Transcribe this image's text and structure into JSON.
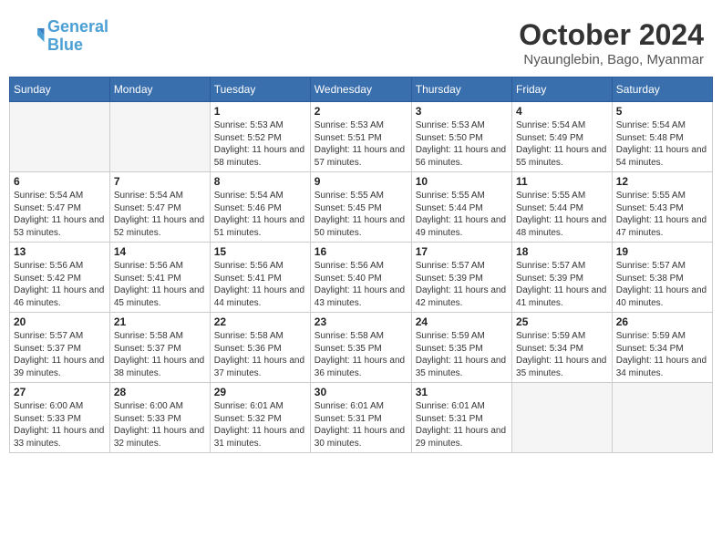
{
  "header": {
    "logo_line1": "General",
    "logo_line2": "Blue",
    "month_title": "October 2024",
    "location": "Nyaunglebin, Bago, Myanmar"
  },
  "weekdays": [
    "Sunday",
    "Monday",
    "Tuesday",
    "Wednesday",
    "Thursday",
    "Friday",
    "Saturday"
  ],
  "weeks": [
    [
      {
        "day": "",
        "info": ""
      },
      {
        "day": "",
        "info": ""
      },
      {
        "day": "1",
        "info": "Sunrise: 5:53 AM\nSunset: 5:52 PM\nDaylight: 11 hours and 58 minutes."
      },
      {
        "day": "2",
        "info": "Sunrise: 5:53 AM\nSunset: 5:51 PM\nDaylight: 11 hours and 57 minutes."
      },
      {
        "day": "3",
        "info": "Sunrise: 5:53 AM\nSunset: 5:50 PM\nDaylight: 11 hours and 56 minutes."
      },
      {
        "day": "4",
        "info": "Sunrise: 5:54 AM\nSunset: 5:49 PM\nDaylight: 11 hours and 55 minutes."
      },
      {
        "day": "5",
        "info": "Sunrise: 5:54 AM\nSunset: 5:48 PM\nDaylight: 11 hours and 54 minutes."
      }
    ],
    [
      {
        "day": "6",
        "info": "Sunrise: 5:54 AM\nSunset: 5:47 PM\nDaylight: 11 hours and 53 minutes."
      },
      {
        "day": "7",
        "info": "Sunrise: 5:54 AM\nSunset: 5:47 PM\nDaylight: 11 hours and 52 minutes."
      },
      {
        "day": "8",
        "info": "Sunrise: 5:54 AM\nSunset: 5:46 PM\nDaylight: 11 hours and 51 minutes."
      },
      {
        "day": "9",
        "info": "Sunrise: 5:55 AM\nSunset: 5:45 PM\nDaylight: 11 hours and 50 minutes."
      },
      {
        "day": "10",
        "info": "Sunrise: 5:55 AM\nSunset: 5:44 PM\nDaylight: 11 hours and 49 minutes."
      },
      {
        "day": "11",
        "info": "Sunrise: 5:55 AM\nSunset: 5:44 PM\nDaylight: 11 hours and 48 minutes."
      },
      {
        "day": "12",
        "info": "Sunrise: 5:55 AM\nSunset: 5:43 PM\nDaylight: 11 hours and 47 minutes."
      }
    ],
    [
      {
        "day": "13",
        "info": "Sunrise: 5:56 AM\nSunset: 5:42 PM\nDaylight: 11 hours and 46 minutes."
      },
      {
        "day": "14",
        "info": "Sunrise: 5:56 AM\nSunset: 5:41 PM\nDaylight: 11 hours and 45 minutes."
      },
      {
        "day": "15",
        "info": "Sunrise: 5:56 AM\nSunset: 5:41 PM\nDaylight: 11 hours and 44 minutes."
      },
      {
        "day": "16",
        "info": "Sunrise: 5:56 AM\nSunset: 5:40 PM\nDaylight: 11 hours and 43 minutes."
      },
      {
        "day": "17",
        "info": "Sunrise: 5:57 AM\nSunset: 5:39 PM\nDaylight: 11 hours and 42 minutes."
      },
      {
        "day": "18",
        "info": "Sunrise: 5:57 AM\nSunset: 5:39 PM\nDaylight: 11 hours and 41 minutes."
      },
      {
        "day": "19",
        "info": "Sunrise: 5:57 AM\nSunset: 5:38 PM\nDaylight: 11 hours and 40 minutes."
      }
    ],
    [
      {
        "day": "20",
        "info": "Sunrise: 5:57 AM\nSunset: 5:37 PM\nDaylight: 11 hours and 39 minutes."
      },
      {
        "day": "21",
        "info": "Sunrise: 5:58 AM\nSunset: 5:37 PM\nDaylight: 11 hours and 38 minutes."
      },
      {
        "day": "22",
        "info": "Sunrise: 5:58 AM\nSunset: 5:36 PM\nDaylight: 11 hours and 37 minutes."
      },
      {
        "day": "23",
        "info": "Sunrise: 5:58 AM\nSunset: 5:35 PM\nDaylight: 11 hours and 36 minutes."
      },
      {
        "day": "24",
        "info": "Sunrise: 5:59 AM\nSunset: 5:35 PM\nDaylight: 11 hours and 35 minutes."
      },
      {
        "day": "25",
        "info": "Sunrise: 5:59 AM\nSunset: 5:34 PM\nDaylight: 11 hours and 35 minutes."
      },
      {
        "day": "26",
        "info": "Sunrise: 5:59 AM\nSunset: 5:34 PM\nDaylight: 11 hours and 34 minutes."
      }
    ],
    [
      {
        "day": "27",
        "info": "Sunrise: 6:00 AM\nSunset: 5:33 PM\nDaylight: 11 hours and 33 minutes."
      },
      {
        "day": "28",
        "info": "Sunrise: 6:00 AM\nSunset: 5:33 PM\nDaylight: 11 hours and 32 minutes."
      },
      {
        "day": "29",
        "info": "Sunrise: 6:01 AM\nSunset: 5:32 PM\nDaylight: 11 hours and 31 minutes."
      },
      {
        "day": "30",
        "info": "Sunrise: 6:01 AM\nSunset: 5:31 PM\nDaylight: 11 hours and 30 minutes."
      },
      {
        "day": "31",
        "info": "Sunrise: 6:01 AM\nSunset: 5:31 PM\nDaylight: 11 hours and 29 minutes."
      },
      {
        "day": "",
        "info": ""
      },
      {
        "day": "",
        "info": ""
      }
    ]
  ]
}
